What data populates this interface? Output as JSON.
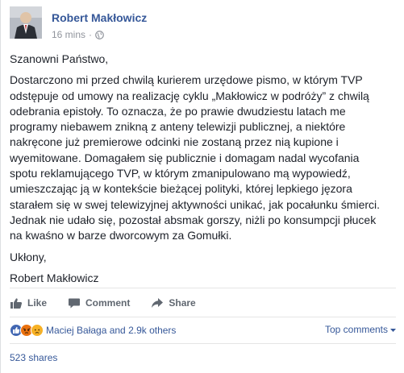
{
  "post": {
    "author": "Robert Makłowicz",
    "timestamp": "16 mins",
    "audience_icon": "globe-icon",
    "paragraphs": [
      [
        "Szanowni Państwo,"
      ],
      [
        "Dostarczono mi przed chwilą kurierem urzędowe pismo, w którym TVP",
        "odstępuje od umowy na realizację cyklu „Makłowicz w podróży” z chwilą",
        "odebrania epistoły. To oznacza, że po prawie dwudziestu latach me",
        "programy niebawem znikną z anteny telewizji publicznej, a niektóre",
        "nakręcone już premierowe odcinki nie zostaną przez nią kupione i",
        "wyemitowane. Domagałem się publicznie i domagam nadal wycofania",
        "spotu reklamującego TVP, w którym zmanipulowano mą wypowiedź,",
        "umieszczając ją w kontekście bieżącej polityki, której lepkiego jęzora",
        "starałem się w swej telewizyjnej aktywności unikać, jak pocałunku śmierci.",
        "Jednak nie udało się, pozostał absmak gorszy, niżli po konsumpcji płucek",
        "na kwaśno w barze dworcowym za Gomułki."
      ],
      [
        "Ukłony,"
      ],
      [
        "Robert Makłowicz"
      ]
    ]
  },
  "actions": {
    "like": "Like",
    "comment": "Comment",
    "share": "Share"
  },
  "reactions": {
    "summary": "Maciej Bałaga and 2.9k others",
    "sort_label": "Top comments",
    "shares": "523 shares"
  },
  "colors": {
    "link": "#365899",
    "like_reaction": "#4267b2",
    "angry_reaction": "#e9710f",
    "sad_reaction": "#f7b125"
  }
}
